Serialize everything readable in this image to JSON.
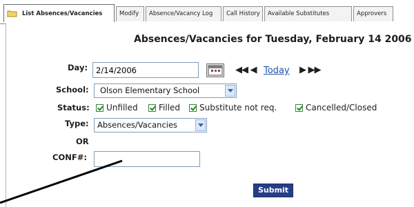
{
  "tabs": [
    {
      "label": "List Absences/Vacancies",
      "active": true
    },
    {
      "label": "Modify"
    },
    {
      "label": "Absence/Vacancy Log"
    },
    {
      "label": "Call History"
    },
    {
      "label": "Available Substitutes"
    },
    {
      "label": "Approvers"
    }
  ],
  "page": {
    "title": "Absences/Vacancies for Tuesday, February 14 2006"
  },
  "form": {
    "day_label": "Day:",
    "day_value": "2/14/2006",
    "nav_prev": "◀◀ ◀",
    "today_link": "Today",
    "nav_next": "▶ ▶▶",
    "school_label": "School:",
    "school_value": "Olson Elementary School",
    "status_label": "Status:",
    "status_options": [
      "Unfilled",
      "Filled",
      "Substitute not req.",
      "Cancelled/Closed"
    ],
    "type_label": "Type:",
    "type_value": "Absences/Vacancies",
    "or_text": "OR",
    "conf_label": "CONF#:",
    "conf_value": "",
    "submit_label": "Submit"
  },
  "icons": {
    "folder": "folder-icon",
    "calendar": "calendar-icon",
    "dropdown": "chevron-down-icon"
  }
}
